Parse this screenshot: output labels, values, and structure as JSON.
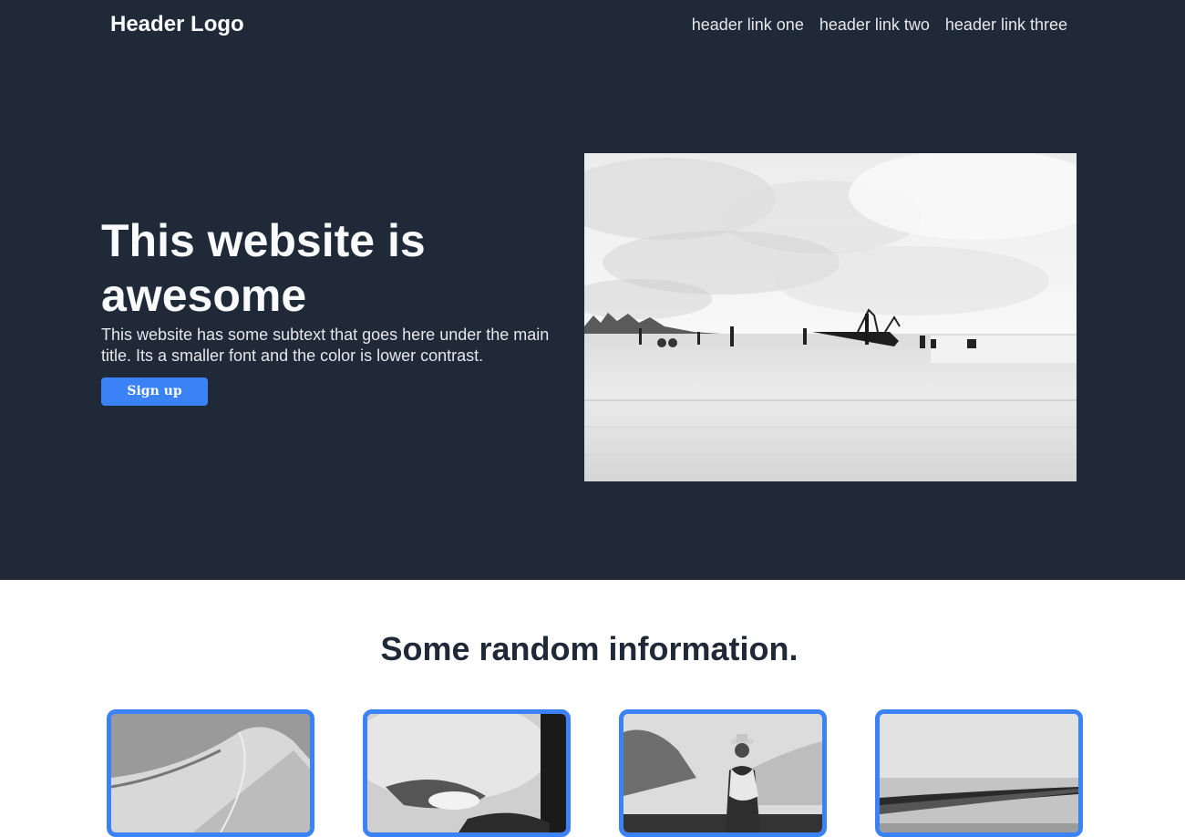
{
  "header": {
    "logo": "Header Logo",
    "links": [
      {
        "label": "header link one"
      },
      {
        "label": "header link two"
      },
      {
        "label": "header link three"
      }
    ]
  },
  "hero": {
    "title": "This website is awesome",
    "subtext": "This website has some subtext that goes here under the main title. Its a smaller font and the color is lower contrast.",
    "cta_label": "Sign up"
  },
  "info": {
    "heading": "Some random information."
  },
  "colors": {
    "dark_bg": "#1f2937",
    "accent": "#3b82f6",
    "light_text": "#f9fafb"
  }
}
